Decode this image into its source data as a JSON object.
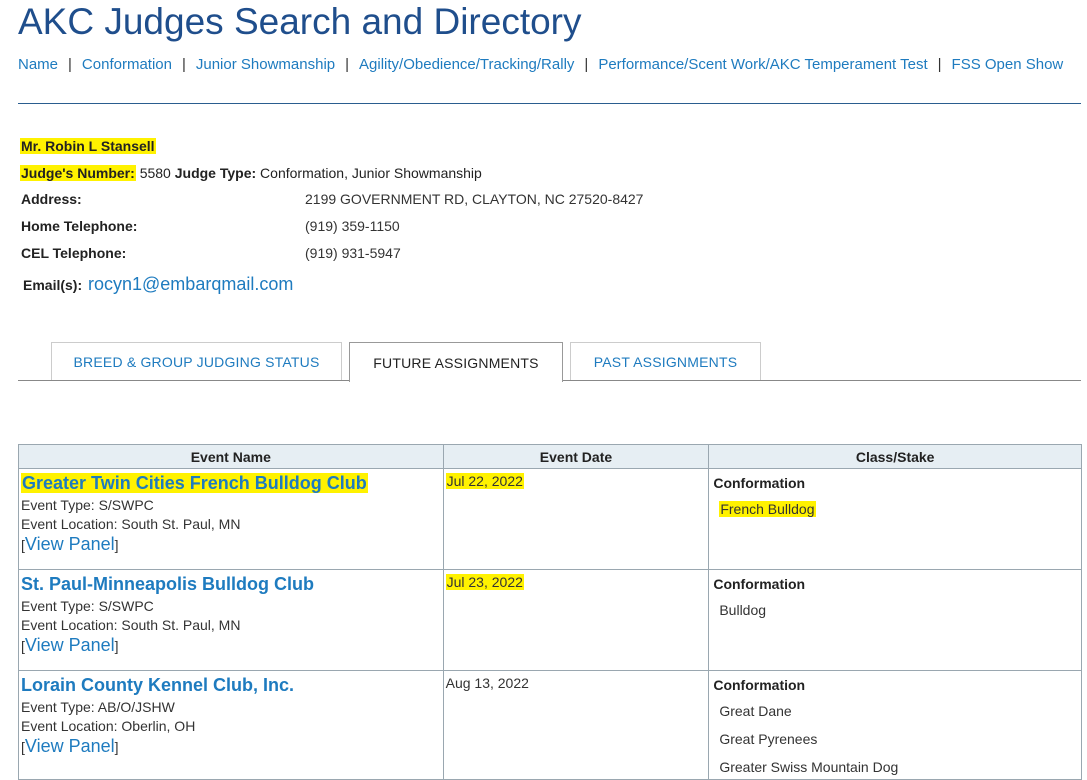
{
  "header": {
    "title": "AKC Judges Search and Directory",
    "nav": [
      "Name",
      "Conformation",
      "Junior Showmanship",
      "Agility/Obedience/Tracking/Rally",
      "Performance/Scent Work/AKC Temperament Test",
      "FSS Open Show"
    ],
    "separator": "|"
  },
  "judge": {
    "name": "Mr. Robin L Stansell",
    "number_label": "Judge's Number:",
    "number": "5580",
    "type_label": "Judge Type:",
    "type": "Conformation, Junior Showmanship",
    "address_label": "Address:",
    "address": "2199 GOVERNMENT RD, CLAYTON, NC 27520-8427",
    "home_phone_label": "Home Telephone:",
    "home_phone": "(919) 359-1150",
    "cel_phone_label": "CEL Telephone:",
    "cel_phone": "(919) 931-5947",
    "email_label": "Email(s):",
    "email": "rocyn1@embarqmail.com"
  },
  "tabs": [
    "BREED & GROUP JUDGING STATUS",
    "FUTURE ASSIGNMENTS",
    "PAST ASSIGNMENTS"
  ],
  "active_tab": "FUTURE ASSIGNMENTS",
  "table": {
    "headers": [
      "Event Name",
      "Event Date",
      "Class/Stake"
    ],
    "rows": [
      {
        "name": "Greater Twin Cities French Bulldog Club",
        "type": "Event Type: S/SWPC",
        "location": "Event Location: South St. Paul, MN",
        "view_open": "[",
        "view_label": "View Panel",
        "view_close": "]",
        "date": "Jul 22, 2022",
        "class": "Conformation",
        "breeds": [
          "French Bulldog"
        ]
      },
      {
        "name": "St. Paul-Minneapolis Bulldog Club",
        "type": "Event Type: S/SWPC",
        "location": "Event Location: South St. Paul, MN",
        "view_open": "[",
        "view_label": "View Panel",
        "view_close": "]",
        "date": "Jul 23, 2022",
        "class": "Conformation",
        "breeds": [
          "Bulldog"
        ]
      },
      {
        "name": "Lorain County Kennel Club, Inc.",
        "type": "Event Type: AB/O/JSHW",
        "location": "Event Location: Oberlin, OH",
        "view_open": "[",
        "view_label": "View Panel",
        "view_close": "]",
        "date": "Aug 13, 2022",
        "class": "Conformation",
        "breeds": [
          "Great Dane",
          "Great Pyrenees",
          "Greater Swiss Mountain Dog"
        ]
      }
    ]
  },
  "colors": {
    "title": "#1f4e8c",
    "link": "#1e7bbf",
    "highlight": "#fff200",
    "header_bg": "#e6eef3"
  }
}
